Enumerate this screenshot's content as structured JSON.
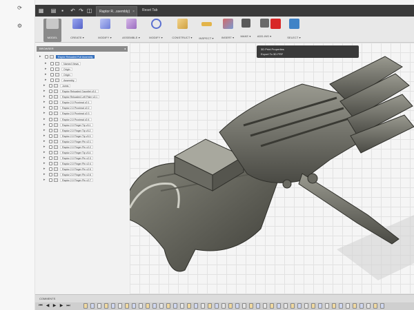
{
  "window": {
    "tab_title": "Raptor R...ssembly)",
    "title_text": "Reset Tab"
  },
  "toolbar": {
    "tools": [
      {
        "label": "MODEL",
        "icon": "model-workspace-icon",
        "active": true
      },
      {
        "label": "CREATE ▾",
        "icon": "create-cube-icon"
      },
      {
        "label": "MODIFY ▾",
        "icon": "modify-icon"
      },
      {
        "label": "ASSEMBLE ▾",
        "icon": "assemble-icon"
      },
      {
        "label": "MODIFY ▾",
        "icon": "rotate-arrows-icon"
      },
      {
        "label": "CONSTRUCT ▾",
        "icon": "construct-plane-icon"
      },
      {
        "label": "INSPECT ▾",
        "icon": "inspect-ruler-icon"
      },
      {
        "label": "INSERT ▾",
        "icon": "insert-image-icon"
      },
      {
        "label": "MAKE ▾",
        "icon": "make-3dprint-icon"
      },
      {
        "label": "ADD-INS ▾",
        "icon": "add-ins-icon"
      },
      {
        "label": "",
        "icon": "print-3d-red-icon"
      },
      {
        "label": "SELECT ▾",
        "icon": "select-cursor-icon"
      }
    ]
  },
  "browser": {
    "header": "BROWSER",
    "root_label": "Raptor Reloaded Full Assembly",
    "items": [
      "Named Views",
      "Origin",
      "Origin",
      "Assembly",
      "Joints",
      "Raptor Reloaded Gauntlet v3:1",
      "Raptor Reloaded Left Palm v3:1",
      "Raptor 2.0 Proximal v2:1",
      "Raptor 2.0 Proximal v2:2",
      "Raptor 2.0 Proximal v2:3",
      "Raptor 2.0 Proximal v2:4",
      "Raptor 2.0 Finger Tip v3:1",
      "Raptor 2.0 Finger Tip v3:2",
      "Raptor 2.0 Finger Tip v3:3",
      "Raptor 2.0 Finger Pin v2:1",
      "Raptor 2.0 Finger Pin v2:2",
      "Raptor 2.0 Finger Tip v3:4",
      "Raptor 2.0 Finger Pin v2:3",
      "Raptor 2.0 Finger Pin v2:4",
      "Raptor 2.0 Finger Pin v2:5",
      "Raptor 2.0 Finger Pin v2:6",
      "Raptor 2.0 Finger Pin v2:7"
    ]
  },
  "popup": {
    "line1": "3D Print Properties",
    "line2": "Export To 3D PRF"
  },
  "comments_label": "COMMENTS"
}
